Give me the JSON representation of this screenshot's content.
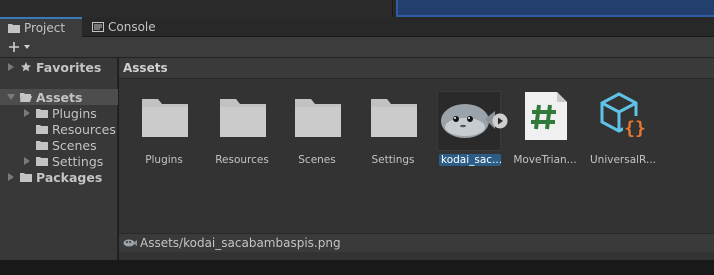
{
  "tabs": [
    {
      "label": "Project",
      "icon": "folder-icon"
    },
    {
      "label": "Console",
      "icon": "console-icon"
    }
  ],
  "toolbar": {
    "add_icon": "plus-icon",
    "add_dropdown_icon": "chevron-down-icon"
  },
  "tree": {
    "favorites": "Favorites",
    "assets": "Assets",
    "assets_children": [
      "Plugins",
      "Resources",
      "Scenes",
      "Settings"
    ],
    "packages": "Packages"
  },
  "breadcrumb": "Assets",
  "assets": [
    {
      "name": "Plugins",
      "kind": "folder"
    },
    {
      "name": "Resources",
      "kind": "folder"
    },
    {
      "name": "Scenes",
      "kind": "folder"
    },
    {
      "name": "Settings",
      "kind": "folder"
    },
    {
      "name": "kodai_sac...",
      "kind": "image"
    },
    {
      "name": "MoveTrian...",
      "kind": "script"
    },
    {
      "name": "UniversalR...",
      "kind": "asset"
    }
  ],
  "status_path": "Assets/kodai_sacabambaspis.png",
  "colors": {
    "accent": "#3a79bb",
    "selection": "#2c5d87",
    "script_green": "#2f7a3a",
    "json_cyan": "#5fc3e8",
    "json_orange": "#e8772e"
  }
}
